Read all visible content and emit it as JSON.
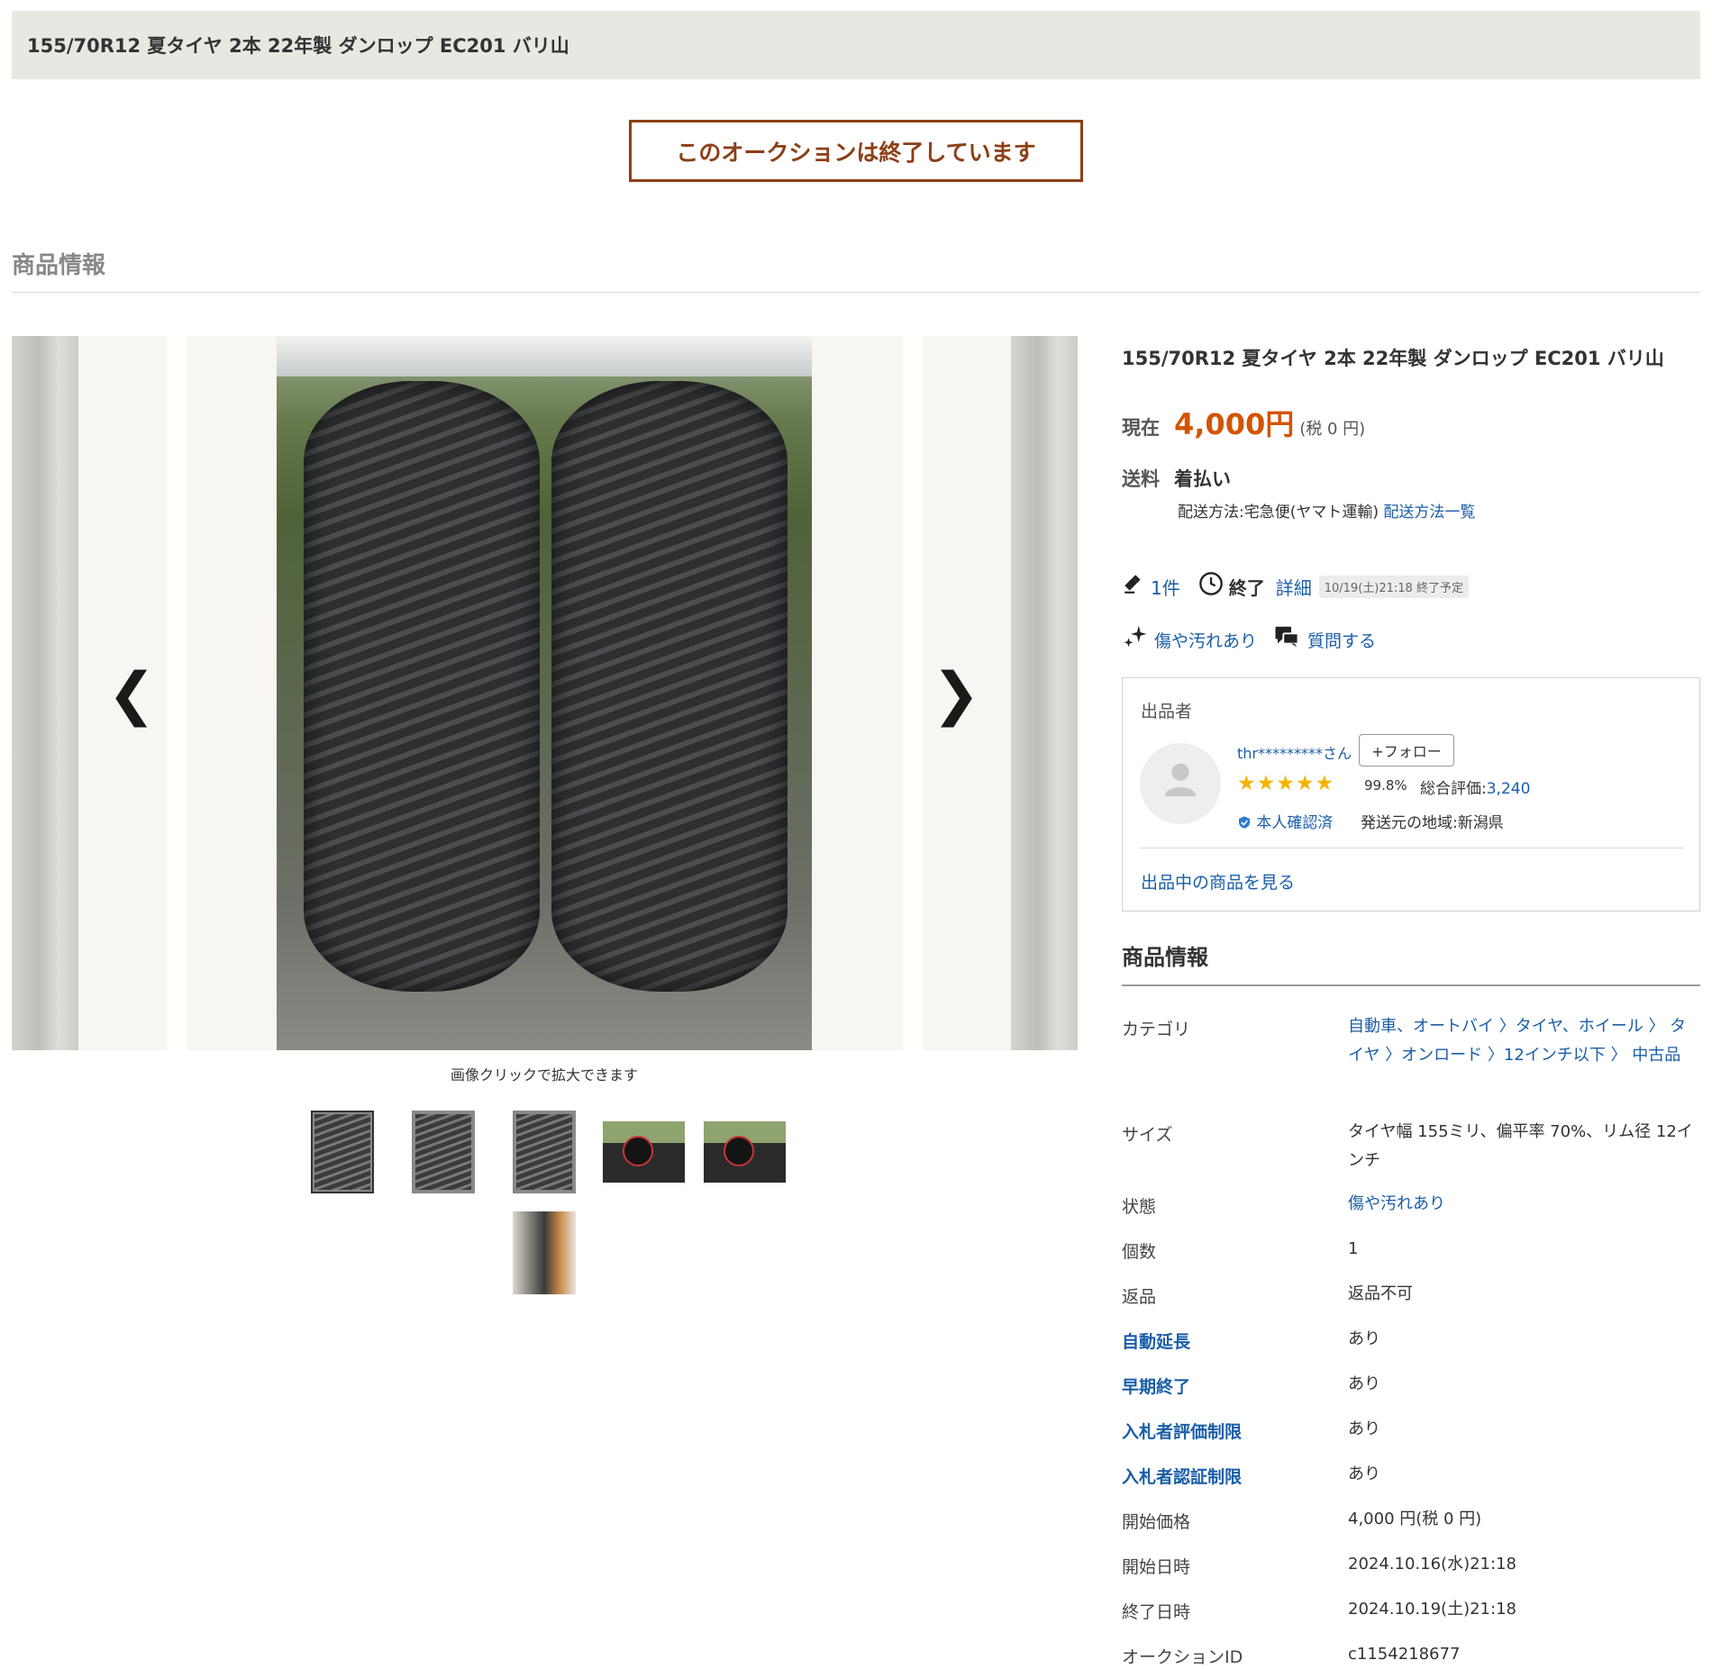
{
  "header": {
    "title": "155/70R12 夏タイヤ 2本 22年製 ダンロップ EC201 バリ山"
  },
  "banner": {
    "text": "このオークションは終了しています"
  },
  "section": {
    "heading": "商品情報"
  },
  "gallery": {
    "caption": "画像クリックで拡大できます",
    "prev_arrow": "❮",
    "next_arrow": "❯",
    "thumbnail_count": 6,
    "selected_index": 0
  },
  "item": {
    "title": "155/70R12 夏タイヤ 2本 22年製 ダンロップ EC201 バリ山",
    "price_label": "現在",
    "price": "4,000円",
    "tax": "(税 0 円)",
    "shipping_label": "送料",
    "shipping_value": "着払い",
    "shipping_method": "配送方法:宅急便(ヤマト運輸)",
    "shipping_link": "配送方法一覧",
    "bids": "1件",
    "status": "終了",
    "detail_link": "詳細",
    "end_badge": "10/19(土)21:18 終了予定",
    "condition_link": "傷や汚れあり",
    "question_link": "質問する"
  },
  "seller": {
    "heading": "出品者",
    "name": "thr*********さん",
    "follow": "+フォロー",
    "stars": "★★★★★",
    "rating_pct": "99.8%",
    "rating_total_label": "総合評価:",
    "rating_total": "3,240",
    "verified": "本人確認済",
    "origin": "発送元の地域:新潟県",
    "items_link": "出品中の商品を見る"
  },
  "info": {
    "heading": "商品情報",
    "rows": [
      {
        "label": "カテゴリ",
        "value": "自動車、オートバイ 〉タイヤ、ホイール 〉 タイヤ 〉オンロード 〉12インチ以下 〉 中古品"
      },
      {
        "label": "サイズ",
        "value": "タイヤ幅 155ミリ、偏平率 70%、リム径 12インチ"
      },
      {
        "label": "状態",
        "value": "傷や汚れあり"
      },
      {
        "label": "個数",
        "value": "1"
      },
      {
        "label": "返品",
        "value": "返品不可"
      },
      {
        "label": "自動延長",
        "value": "あり"
      },
      {
        "label": "早期終了",
        "value": "あり"
      },
      {
        "label": "入札者評価制限",
        "value": "あり"
      },
      {
        "label": "入札者認証制限",
        "value": "あり"
      },
      {
        "label": "開始価格",
        "value": "4,000 円(税 0 円)"
      },
      {
        "label": "開始日時",
        "value": "2024.10.16(水)21:18"
      },
      {
        "label": "終了日時",
        "value": "2024.10.19(土)21:18"
      },
      {
        "label": "オークションID",
        "value": "c1154218677"
      }
    ]
  },
  "colors": {
    "accent": "#8c3f16",
    "price": "#d35400",
    "link": "#1a5ea8",
    "star": "#f5b400"
  },
  "icons": [
    "hammer-icon",
    "clock-icon",
    "sparkle-icon",
    "chat-icon",
    "person-icon",
    "verified-shield-icon",
    "chevron-left-icon",
    "chevron-right-icon"
  ]
}
